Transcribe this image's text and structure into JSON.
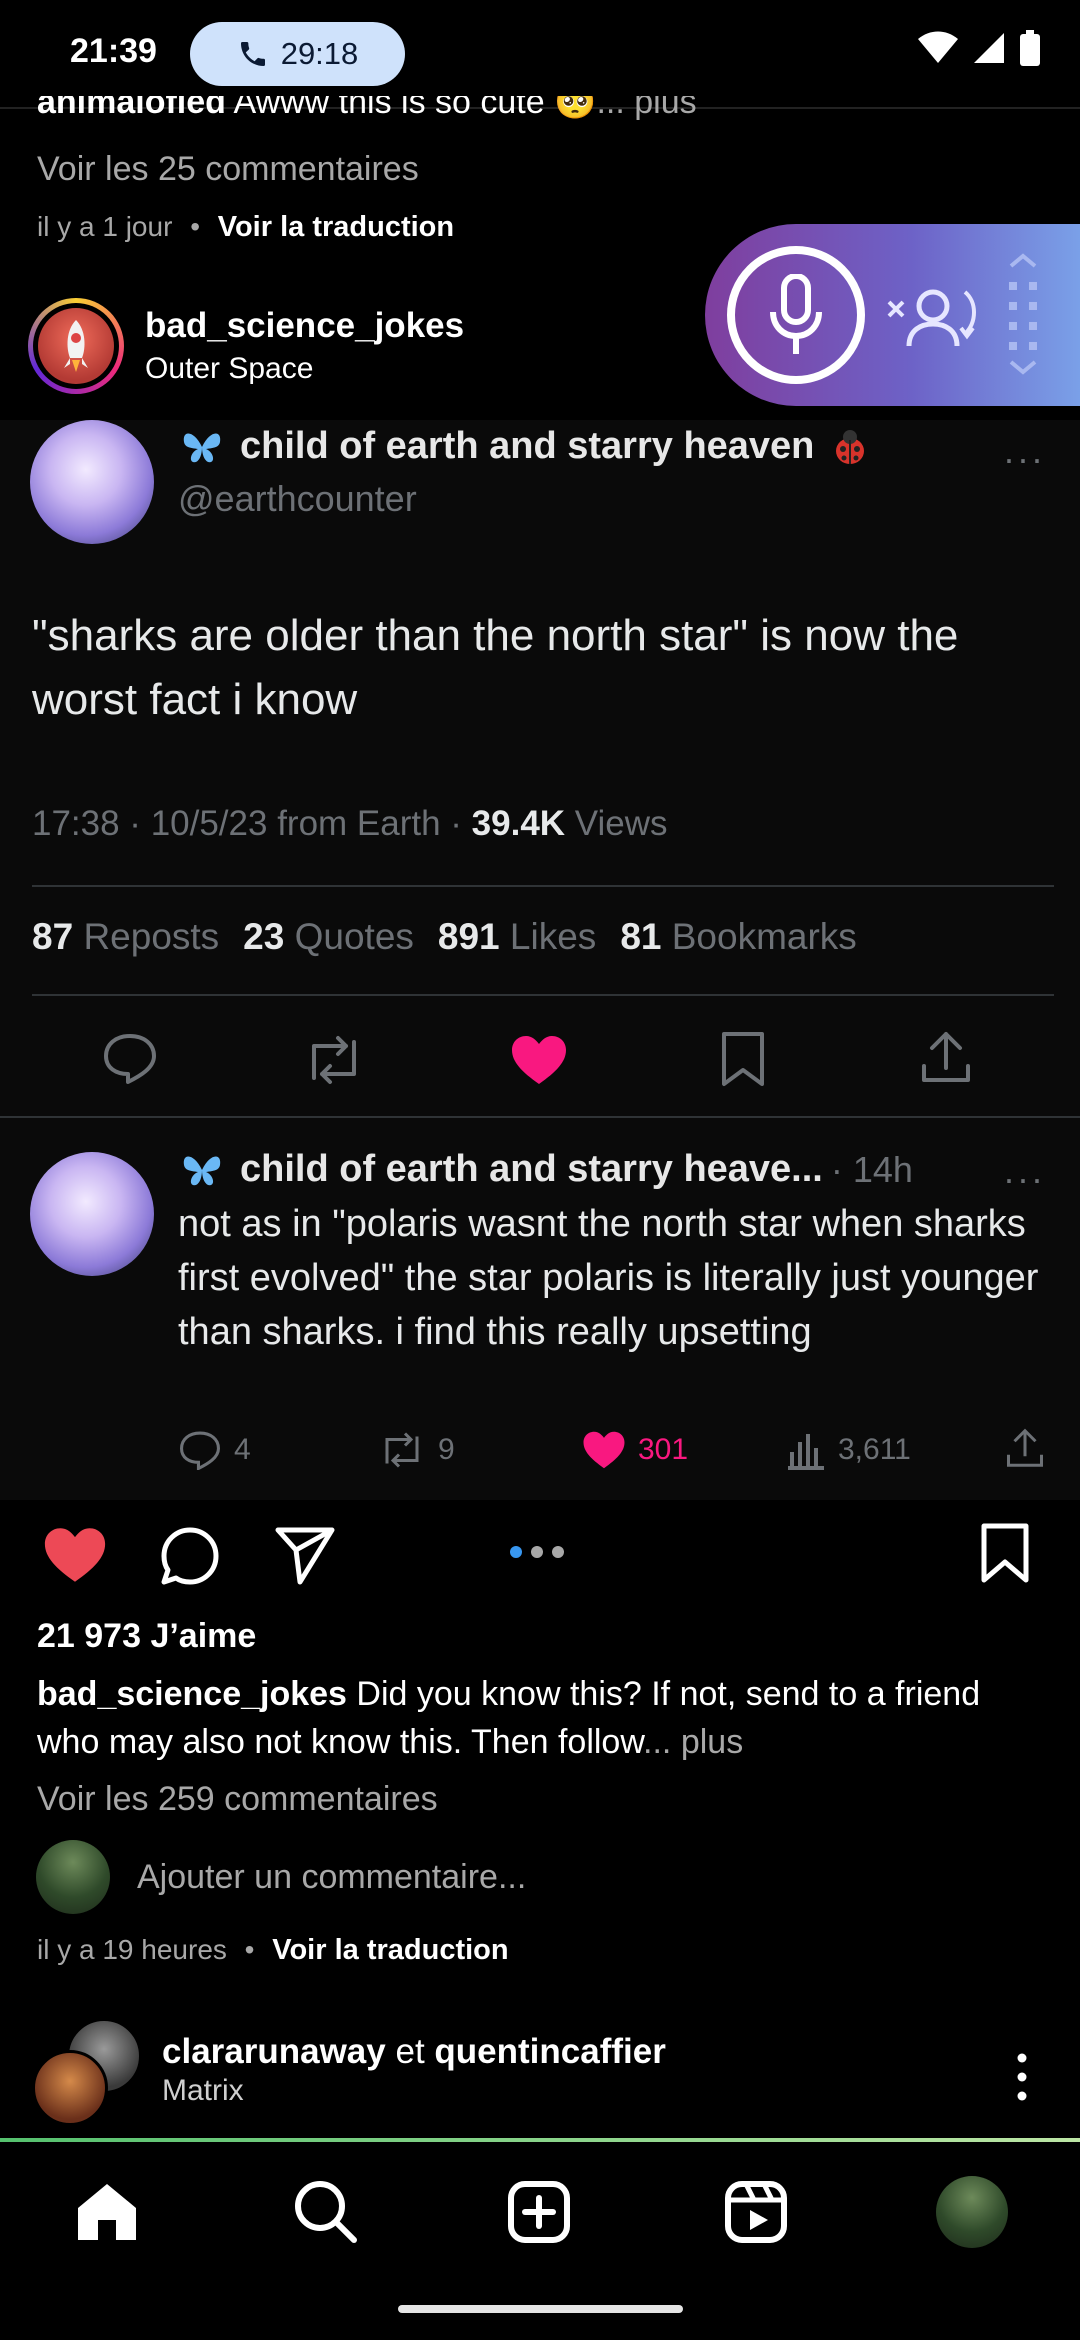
{
  "status_bar": {
    "time": "21:39",
    "call_timer": "29:18"
  },
  "prev_post": {
    "caption_user": "animalofied",
    "caption_text": "Awww this is so cute",
    "caption_emoji": "🥺",
    "caption_more": "... plus",
    "comments_link": "Voir les 25 commentaires",
    "timestamp": "il y a 1 jour",
    "translate": "Voir la traduction"
  },
  "post": {
    "username": "bad_science_jokes",
    "location": "Outer Space",
    "tweet": {
      "name": "child of earth and starry heaven",
      "handle": "@earthcounter",
      "text": "\"sharks are older than the north star\" is now the worst fact i know",
      "meta_time": "17:38 · 10/5/23 from Earth · ",
      "views_count": "39.4K",
      "views_label": " Views",
      "reposts_count": "87",
      "reposts_label": "Reposts",
      "quotes_count": "23",
      "quotes_label": "Quotes",
      "likes_count": "891",
      "likes_label": "Likes",
      "bookmarks_count": "81",
      "bookmarks_label": "Bookmarks"
    },
    "reply": {
      "name": "child of earth and starry heave...",
      "age": "· 14h",
      "text": "not as in \"polaris wasnt the north star when sharks first evolved\" the star polaris is literally just younger than sharks. i find this really upsetting",
      "replies": "4",
      "reposts": "9",
      "likes": "301",
      "views": "3,611"
    },
    "likes_text": "21 973 J’aime",
    "caption_user": "bad_science_jokes",
    "caption_text": "Did you know this? If not, send to a friend who may also not know this. Then follow",
    "caption_more": "... plus",
    "comments_link": "Voir les 259 commentaires",
    "add_comment_placeholder": "Ajouter un commentaire...",
    "timestamp": "il y a 19 heures",
    "translate": "Voir la traduction"
  },
  "next_post": {
    "user1": "clararunaway",
    "joiner": "et",
    "user2": "quentincaffier",
    "location": "Matrix"
  },
  "colors": {
    "like_red": "#ed4956",
    "tweet_like_pink": "#f91880",
    "twitter_blue": "#1d9bf0"
  }
}
